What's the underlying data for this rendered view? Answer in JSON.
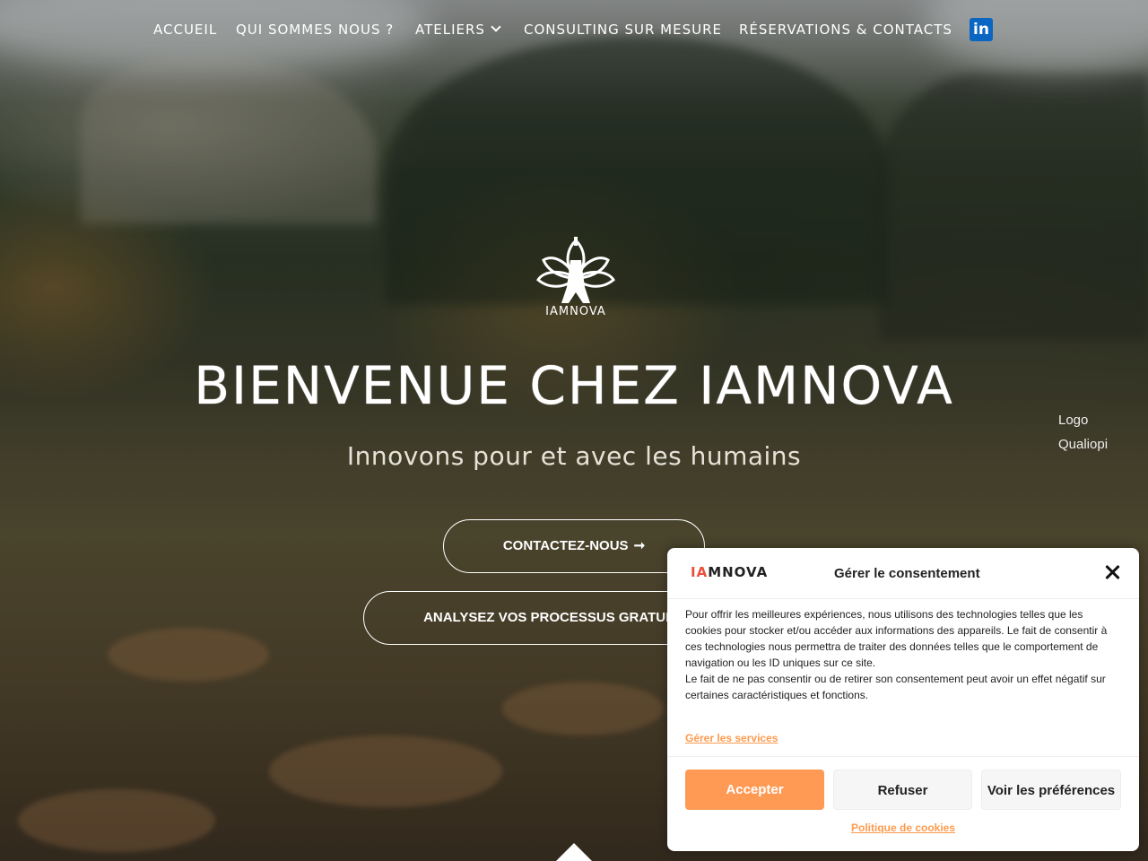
{
  "nav": {
    "items": [
      {
        "label": "ACCUEIL"
      },
      {
        "label": "QUI SOMMES NOUS ?"
      },
      {
        "label": "ATELIERS"
      },
      {
        "label": "CONSULTING SUR MESURE"
      },
      {
        "label": "RÉSERVATIONS & CONTACTS"
      }
    ],
    "linkedin_label": "in",
    "linkedin_color": "#0a66c2"
  },
  "hero": {
    "logo_text": "IAMNOVA",
    "title": "BIENVENUE CHEZ IAMNOVA",
    "subtitle": "Innovons pour et avec les humains",
    "contact_button": "CONTACTEZ-NOUS",
    "contact_arrow": "➞",
    "analyse_button": "ANALYSEZ VOS PROCESSUS GRATUITEMENT",
    "qualiopi_alt": "Logo Qualiopi"
  },
  "consent": {
    "logo_ia": "IA",
    "logo_rest": "MNOVA",
    "title": "Gérer le consentement",
    "paragraph1": "Pour offrir les meilleures expériences, nous utilisons des technologies telles que les cookies pour stocker et/ou accéder aux informations des appareils. Le fait de consentir à ces technologies nous permettra de traiter des données telles que le comportement de navigation ou les ID uniques sur ce site.",
    "paragraph2": "Le fait de ne pas consentir ou de retirer son consentement peut avoir un effet négatif sur certaines caractéristiques et fonctions.",
    "manage_services": "Gérer les services",
    "accept": "Accepter",
    "refuse": "Refuser",
    "preferences": "Voir les préférences",
    "cookie_policy": "Politique de cookies",
    "accent_color": "#ff9a55"
  }
}
